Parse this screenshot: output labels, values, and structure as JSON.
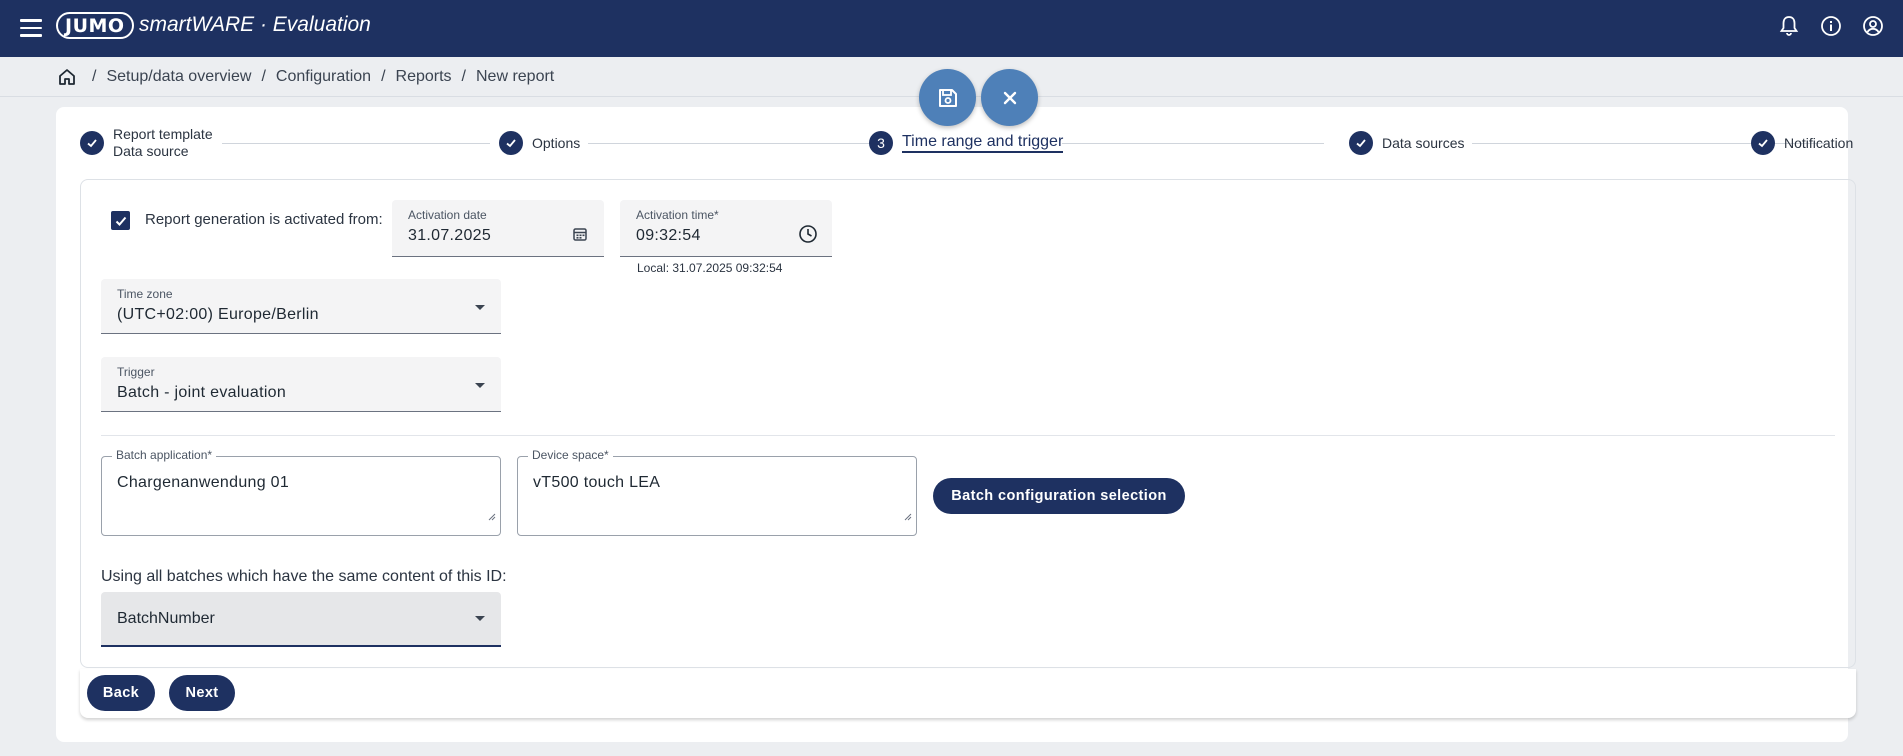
{
  "app": {
    "logo": "JUMO",
    "title": "smartWARE · Evaluation",
    "brand_color": "#1e3161",
    "fab_color": "#4e80b8"
  },
  "header_icons": [
    "bell-icon",
    "info-icon",
    "account-icon"
  ],
  "breadcrumb": [
    "Setup/data overview",
    "Configuration",
    "Reports",
    "New report"
  ],
  "stepper": {
    "steps": [
      {
        "line1": "Report template",
        "line2": "Data source",
        "state": "done"
      },
      {
        "label": "Options",
        "state": "done"
      },
      {
        "number": "3",
        "label": "Time range and trigger",
        "state": "active"
      },
      {
        "label": "Data sources",
        "state": "done"
      },
      {
        "label": "Notification",
        "state": "done"
      }
    ]
  },
  "form": {
    "activation_checkbox_label": "Report generation is activated from:",
    "activation_checked": true,
    "activation_date": {
      "label": "Activation date",
      "value": "31.07.2025"
    },
    "activation_time": {
      "label": "Activation time*",
      "value": "09:32:54",
      "hint": "Local: 31.07.2025 09:32:54"
    },
    "time_zone": {
      "label": "Time zone",
      "value": "(UTC+02:00) Europe/Berlin"
    },
    "trigger": {
      "label": "Trigger",
      "value": "Batch - joint evaluation"
    },
    "batch_application": {
      "label": "Batch application*",
      "value": "Chargenanwendung 01"
    },
    "device_space": {
      "label": "Device space*",
      "value": "vT500 touch LEA"
    },
    "batch_config_button": "Batch configuration selection",
    "id_label": "Using all batches which have the same content of this ID:",
    "id_select": {
      "value": "BatchNumber"
    }
  },
  "footer": {
    "back_label": "Back",
    "next_label": "Next"
  }
}
